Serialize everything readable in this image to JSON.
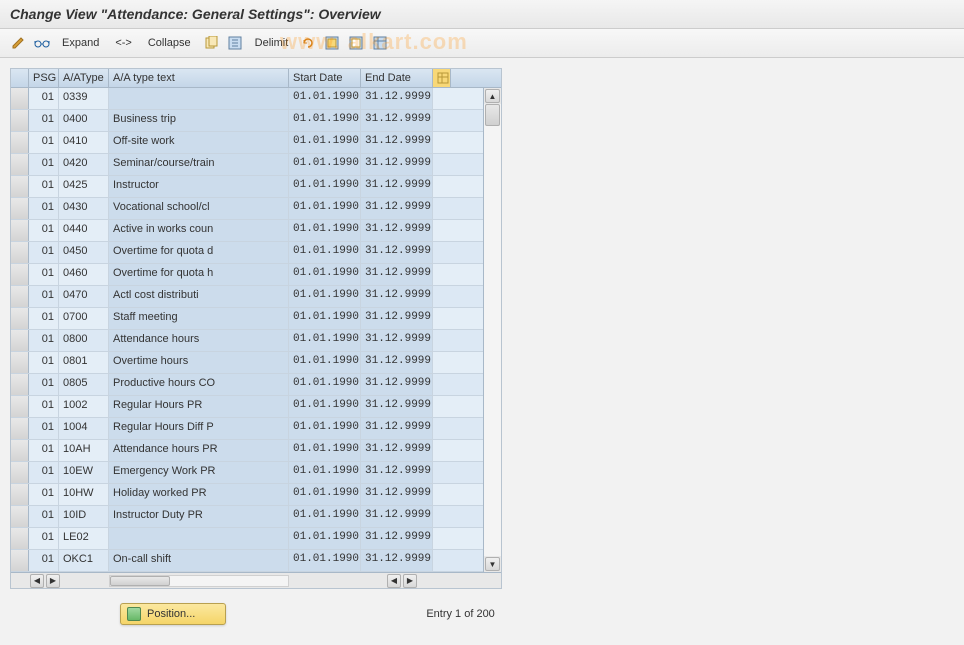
{
  "title": "Change View \"Attendance: General Settings\": Overview",
  "watermark": "www.            alkart.com",
  "toolbar": {
    "expand": "Expand",
    "arrow": "<->",
    "collapse": "Collapse",
    "delimit": "Delimit"
  },
  "columns": {
    "psg": "PSG",
    "type": "A/AType",
    "text": "A/A type text",
    "start": "Start Date",
    "end": "End Date"
  },
  "rows": [
    {
      "psg": "01",
      "type": "0339",
      "text": "",
      "start": "01.01.1990",
      "end": "31.12.9999"
    },
    {
      "psg": "01",
      "type": "0400",
      "text": "Business trip",
      "start": "01.01.1990",
      "end": "31.12.9999"
    },
    {
      "psg": "01",
      "type": "0410",
      "text": "Off-site work",
      "start": "01.01.1990",
      "end": "31.12.9999"
    },
    {
      "psg": "01",
      "type": "0420",
      "text": "Seminar/course/train",
      "start": "01.01.1990",
      "end": "31.12.9999"
    },
    {
      "psg": "01",
      "type": "0425",
      "text": "Instructor",
      "start": "01.01.1990",
      "end": "31.12.9999"
    },
    {
      "psg": "01",
      "type": "0430",
      "text": "Vocational school/cl",
      "start": "01.01.1990",
      "end": "31.12.9999"
    },
    {
      "psg": "01",
      "type": "0440",
      "text": "Active in works coun",
      "start": "01.01.1990",
      "end": "31.12.9999"
    },
    {
      "psg": "01",
      "type": "0450",
      "text": "Overtime for quota d",
      "start": "01.01.1990",
      "end": "31.12.9999"
    },
    {
      "psg": "01",
      "type": "0460",
      "text": "Overtime for quota h",
      "start": "01.01.1990",
      "end": "31.12.9999"
    },
    {
      "psg": "01",
      "type": "0470",
      "text": "Actl cost distributi",
      "start": "01.01.1990",
      "end": "31.12.9999"
    },
    {
      "psg": "01",
      "type": "0700",
      "text": "Staff meeting",
      "start": "01.01.1990",
      "end": "31.12.9999"
    },
    {
      "psg": "01",
      "type": "0800",
      "text": "Attendance hours",
      "start": "01.01.1990",
      "end": "31.12.9999"
    },
    {
      "psg": "01",
      "type": "0801",
      "text": "Overtime hours",
      "start": "01.01.1990",
      "end": "31.12.9999"
    },
    {
      "psg": "01",
      "type": "0805",
      "text": "Productive hours CO",
      "start": "01.01.1990",
      "end": "31.12.9999"
    },
    {
      "psg": "01",
      "type": "1002",
      "text": "Regular Hours PR",
      "start": "01.01.1990",
      "end": "31.12.9999"
    },
    {
      "psg": "01",
      "type": "1004",
      "text": "Regular Hours Diff P",
      "start": "01.01.1990",
      "end": "31.12.9999"
    },
    {
      "psg": "01",
      "type": "10AH",
      "text": "Attendance hours PR",
      "start": "01.01.1990",
      "end": "31.12.9999"
    },
    {
      "psg": "01",
      "type": "10EW",
      "text": "Emergency Work PR",
      "start": "01.01.1990",
      "end": "31.12.9999"
    },
    {
      "psg": "01",
      "type": "10HW",
      "text": "Holiday worked PR",
      "start": "01.01.1990",
      "end": "31.12.9999"
    },
    {
      "psg": "01",
      "type": "10ID",
      "text": "Instructor Duty PR",
      "start": "01.01.1990",
      "end": "31.12.9999"
    },
    {
      "psg": "01",
      "type": "LE02",
      "text": "",
      "start": "01.01.1990",
      "end": "31.12.9999"
    },
    {
      "psg": "01",
      "type": "OKC1",
      "text": "On-call shift",
      "start": "01.01.1990",
      "end": "31.12.9999"
    }
  ],
  "footer": {
    "position": "Position...",
    "entry": "Entry 1 of 200"
  }
}
